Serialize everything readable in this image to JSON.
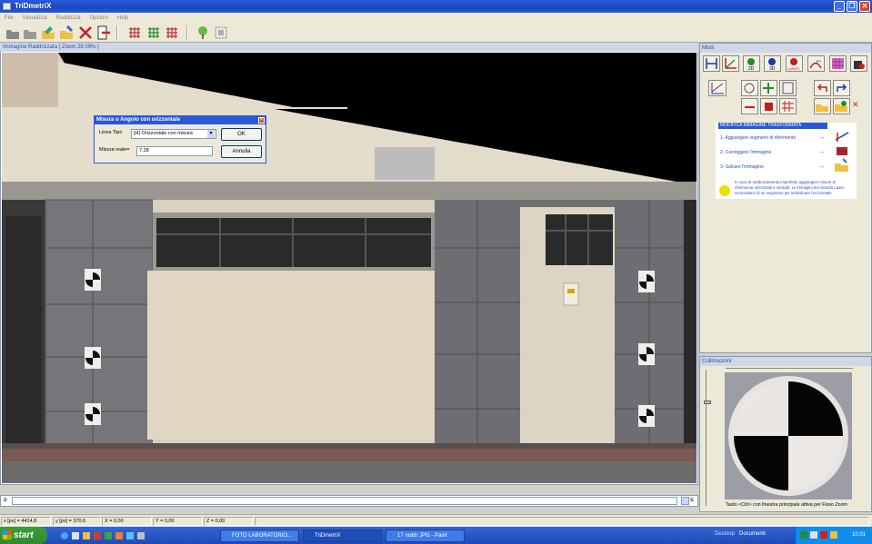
{
  "window": {
    "title": "TriDmetriX"
  },
  "menu": [
    "File",
    "Visualizza",
    "Raddrizza",
    "Opzioni",
    "Help"
  ],
  "toolbar": {
    "icons": [
      "open-folder-icon",
      "save-icon",
      "wizard-icon",
      "rectify-icon",
      "delete-icon",
      "exit-icon",
      "grid-a-icon",
      "grid-b-icon",
      "grid-c-icon",
      "tree-icon",
      "frame-icon"
    ]
  },
  "image_panel": {
    "caption": "Immagine Raddrizzata [ Zoom 28,09% ]"
  },
  "dialog": {
    "title": "Misura o Angolo con orizzontale",
    "line_type_label": "Linea Tipo",
    "line_type_value": "[H] Orizzontale con misura",
    "measure_label": "Misura reale=",
    "measure_value": "7.28",
    "ok_label": "OK",
    "cancel_label": "Annulla"
  },
  "modi_panel": {
    "caption": "Modi",
    "top_buttons": [
      "axes-icon",
      "corner-icon",
      "2d-icon",
      "3d-icon",
      "laser-icon",
      "curve-icon",
      "palette-icon",
      "paint-icon"
    ],
    "top_button_labels": [
      "",
      "",
      "2D",
      "3D",
      "LASER",
      "P?",
      "",
      ""
    ],
    "help_title": "MODIFICA IMMAGINE TRASFORMATA",
    "steps": [
      "1- Aggiungere segmenti di riferimento",
      "2- Correggere l'immagine",
      "3- Salvare l'immagine"
    ],
    "arrow": "→",
    "note": "In caso di raddrizzamento imperfetto aggiungere misure di riferimento orizzontali e verticali. Le immagini del metodo Laser necessitano di un segmento per individuare l'orizzontale"
  },
  "collimation_panel": {
    "caption": "Collimazioni",
    "hint": "Tasto <Ctrl> con finestra principale attiva per Fisso Zoom"
  },
  "command": {
    "prompt": "≥",
    "right_label": "≤"
  },
  "status": {
    "xpx": "x [px] = 4414,8",
    "ypx": "y [px] = 370,6",
    "x": "X = 0,00",
    "y": "Y = 0,00",
    "z": "Z = 0,00"
  },
  "taskbar": {
    "start": "start",
    "tasks": [
      "FOTO LABORATORIO...",
      "TriDmetriX",
      "17 raddr JPG - Paint"
    ],
    "desktop_label": "Desktop",
    "documents_label": "Documenti",
    "time": "10.01"
  },
  "colors": {
    "titlebar": "#1a46c0",
    "taskbar": "#245edb",
    "start": "#2f8a2f",
    "help_title": "#2b59d6"
  }
}
